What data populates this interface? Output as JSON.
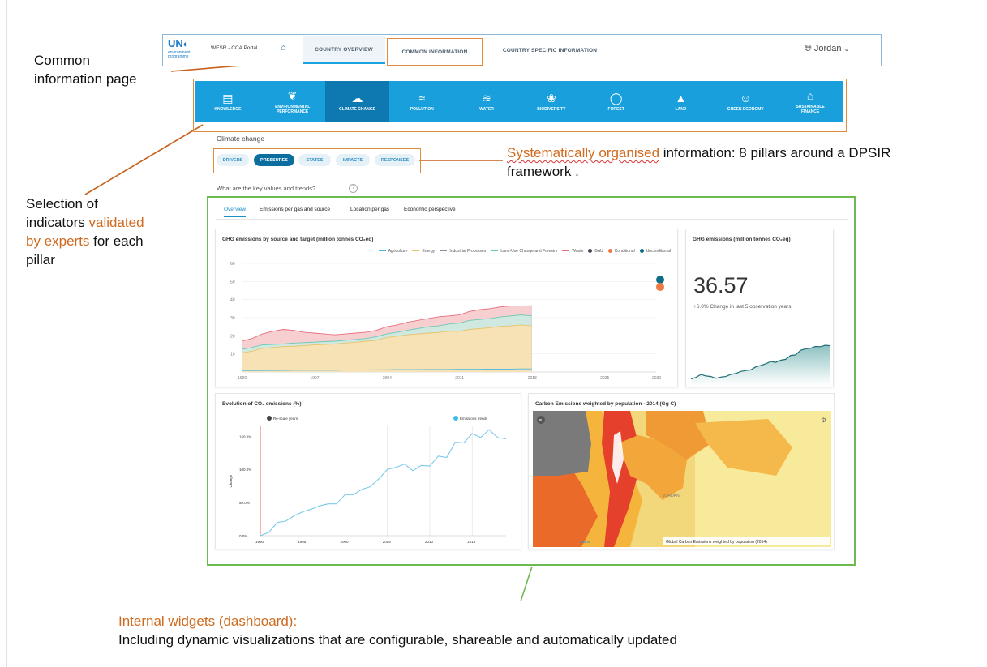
{
  "annotations": {
    "common_info": [
      "Common",
      "information page"
    ],
    "selection": [
      "Selection of",
      "indicators ",
      "validated",
      "by experts",
      " for each",
      "pillar"
    ],
    "dpsir": [
      "Systematically organised",
      " information: 8 pillars around a DPSIR",
      "framework ."
    ],
    "widgets_title": "Internal widgets (dashboard):",
    "widgets_text": "Including dynamic visualizations that are  configurable, shareable and automatically updated"
  },
  "header": {
    "logo": "UN",
    "logo_sub": "environment programme",
    "portal": "WESR - CCA Portal",
    "tabs": [
      "COUNTRY OVERVIEW",
      "COMMON INFORMATION",
      "COUNTRY SPECIFIC INFORMATION"
    ],
    "country": "Jordan"
  },
  "pillars": [
    {
      "label": "KNOWLEDGE",
      "icon": "book-icon"
    },
    {
      "label": "ENVIRONMENTAL PERFORMANCE",
      "icon": "leaf-icon"
    },
    {
      "label": "CLIMATE CHANGE",
      "icon": "cloud-sun-icon"
    },
    {
      "label": "POLLUTION",
      "icon": "smoke-icon"
    },
    {
      "label": "WATER",
      "icon": "waves-icon"
    },
    {
      "label": "BIODIVERSITY",
      "icon": "butterfly-icon"
    },
    {
      "label": "FOREST",
      "icon": "tree-icon"
    },
    {
      "label": "LAND",
      "icon": "mountain-icon"
    },
    {
      "label": "GREEN ECONOMY",
      "icon": "people-icon"
    },
    {
      "label": "SUSTAINABLE FINANCE",
      "icon": "bank-icon"
    }
  ],
  "section_title": "Climate change",
  "dpsir_tabs": [
    "DRIVERS",
    "PRESSURES",
    "STATES",
    "IMPACTS",
    "RESPONSES"
  ],
  "question": "What are the key values and trends?",
  "subtabs": [
    "Overview",
    "Emissions per gas and source",
    "Location per gas",
    "Economic perspective"
  ],
  "kpi": {
    "title": "GHG emissions (million tonnes CO₂eq)",
    "value": "36.57",
    "change": "+6.0% Change in last 5 observation years"
  },
  "colors": {
    "primary": "#19a0dc",
    "annotation": "#d06a1e",
    "highlight": "#6cba50"
  },
  "chart_data": [
    {
      "type": "area",
      "title": "GHG emissions by source and target (million tonnes CO₂eq)",
      "legend": [
        "Agriculture",
        "Energy",
        "Industrial Processes",
        "Land-Use Change and Forestry",
        "Waste",
        "BAU",
        "Conditional",
        "Unconditional"
      ],
      "legend_colors": [
        "#44b6e0",
        "#e7c36a",
        "#7c8da0",
        "#6cc9b4",
        "#e76f7d",
        "#444a55",
        "#f07a45",
        "#0f6c87"
      ],
      "x": [
        1990,
        1991,
        1992,
        1993,
        1994,
        1995,
        1996,
        1997,
        1998,
        1999,
        2000,
        2001,
        2002,
        2003,
        2004,
        2005,
        2006,
        2007,
        2008,
        2009,
        2010,
        2011,
        2012,
        2013,
        2014,
        2015,
        2016,
        2017,
        2018
      ],
      "xticks": [
        1990,
        1997,
        2004,
        2011,
        2018,
        2025,
        2030
      ],
      "yticks": [
        10,
        20,
        30,
        40,
        50,
        60
      ],
      "ylim": [
        0,
        60
      ],
      "xlim": [
        1990,
        2030
      ],
      "series": [
        {
          "name": "Energy",
          "values": [
            10.5,
            11.5,
            13,
            13.5,
            14,
            14.2,
            14.5,
            15,
            15.2,
            15.5,
            16,
            16.4,
            17,
            17.5,
            19,
            19.8,
            20.5,
            21,
            21.5,
            21.8,
            22.5,
            22.5,
            23.5,
            24,
            24.5,
            25.2,
            25.5,
            26,
            25.5
          ]
        },
        {
          "name": "Land-Use Change and Forestry",
          "values": [
            12.5,
            13.5,
            15,
            15.2,
            15.5,
            16,
            16.2,
            16.5,
            16.8,
            17,
            17.5,
            18,
            18.5,
            19.5,
            21,
            22,
            23,
            24,
            25,
            25.5,
            26.5,
            27,
            28.5,
            29,
            29.5,
            30.5,
            31,
            31.5,
            31
          ]
        },
        {
          "name": "Waste",
          "values": [
            17,
            18.5,
            21,
            22.5,
            23.5,
            23,
            22,
            21.5,
            21,
            20.5,
            21,
            21.5,
            22,
            23,
            25,
            26,
            27.5,
            28.5,
            29.5,
            30.5,
            31,
            31.5,
            33.5,
            34.5,
            35,
            36,
            36.5,
            36.5,
            36.6
          ]
        },
        {
          "name": "Industrial Processes",
          "values": [
            0.8,
            0.8,
            0.8,
            0.9,
            0.9,
            1,
            1,
            1,
            1,
            1,
            1.1,
            1.1,
            1.1,
            1.2,
            1.2,
            1.3,
            1.3,
            1.3,
            1.4,
            1.4,
            1.4,
            1.5,
            1.5,
            1.5,
            1.6,
            1.6,
            1.6,
            1.7,
            1.7
          ]
        }
      ],
      "targets": [
        {
          "name": "Unconditional",
          "x": 2030,
          "y": 51
        },
        {
          "name": "Conditional",
          "x": 2030,
          "y": 47
        }
      ]
    },
    {
      "type": "line",
      "title": "Evolution of CO₂ emissions (%)",
      "legend": [
        "Re-scale years",
        "Emissions trends"
      ],
      "ylabel": "Change",
      "x": [
        1991,
        1992,
        1993,
        1994,
        1995,
        1996,
        1997,
        1998,
        1999,
        2000,
        2001,
        2002,
        2003,
        2004,
        2005,
        2006,
        2007,
        2008,
        2009,
        2010,
        2011,
        2012,
        2013,
        2014,
        2015,
        2016,
        2017,
        2018,
        2019
      ],
      "values": [
        5,
        20,
        22,
        30,
        36,
        40,
        45,
        48,
        48,
        62,
        62,
        70,
        74,
        86,
        100,
        103,
        108,
        98,
        106,
        105,
        120,
        118,
        141,
        140,
        154,
        148,
        160,
        148,
        146
      ],
      "xticks": [
        1990,
        1995,
        2000,
        2005,
        2010,
        2015
      ],
      "yticks": [
        "0.0%",
        "50.0%",
        "100.0%",
        "150.0%"
      ],
      "ylim": [
        0,
        165
      ],
      "xlim": [
        1990,
        2019
      ]
    },
    {
      "type": "area",
      "title": "",
      "values": [
        2,
        2.5,
        3.5,
        3,
        2.8,
        2.2,
        2.6,
        2.8,
        3.5,
        3.8,
        4.5,
        4.8,
        5,
        6,
        6.5,
        7,
        7.8,
        7.5,
        8.2,
        8.5,
        9.8,
        10,
        11.5,
        12,
        12.2,
        12.8,
        12.7,
        13.2,
        13
      ]
    }
  ],
  "map": {
    "title": "Carbon Emissions weighted by population - 2014 (Gg C)",
    "label": "JORDAN",
    "caption": "Global Carbon Emissions weighted by population (2014)",
    "credit": "maps"
  }
}
